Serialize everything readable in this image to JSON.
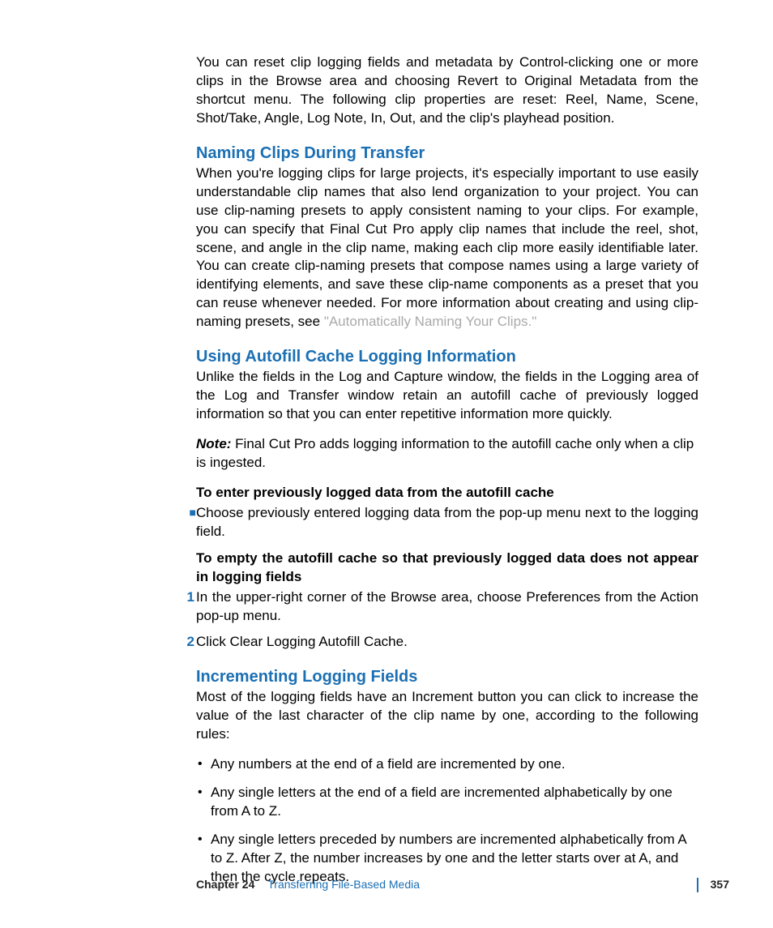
{
  "intro": "You can reset clip logging fields and metadata by Control-clicking one or more clips in the Browse area and choosing Revert to Original Metadata from the shortcut menu. The following clip properties are reset: Reel, Name, Scene, Shot/Take, Angle, Log Note, In, Out, and the clip's playhead position.",
  "s1": {
    "title": "Naming Clips During Transfer",
    "body_a": "When you're logging clips for large projects, it's especially important to use easily understandable clip names that also lend organization to your project. You can use clip-naming presets to apply consistent naming to your clips. For example, you can specify that Final Cut Pro apply clip names that include the reel, shot, scene, and angle in the clip name, making each clip more easily identifiable later. You can create clip-naming presets that compose names using a large variety of identifying elements, and save these clip-name components as a preset that you can reuse whenever needed. For more information about creating and using clip-naming presets, see ",
    "link": "\"Automatically Naming Your Clips.\""
  },
  "s2": {
    "title": "Using Autofill Cache Logging Information",
    "body": "Unlike the fields in the Log and Capture window, the fields in the Logging area of the Log and Transfer window retain an autofill cache of previously logged information so that you can enter repetitive information more quickly.",
    "note_label": "Note:",
    "note": "  Final Cut Pro adds logging information to the autofill cache only when a clip is ingested.",
    "sub1": "To enter previously logged data from the autofill cache",
    "bullet1": "Choose previously entered logging data from the pop-up menu next to the logging field.",
    "sub2": "To empty the autofill cache so that previously logged data does not appear in logging fields",
    "step1": "In the upper-right corner of the Browse area, choose Preferences from the Action pop-up menu.",
    "step2": "Click Clear Logging Autofill Cache."
  },
  "s3": {
    "title": "Incrementing Logging Fields",
    "body": "Most of the logging fields have an Increment button you can click to increase the value of the last character of the clip name by one, according to the following rules:",
    "b1": "Any numbers at the end of a field are incremented by one.",
    "b2": "Any single letters at the end of a field are incremented alphabetically by one from A to Z.",
    "b3": "Any single letters preceded by numbers are incremented alphabetically from A to Z. After Z, the number increases by one and the letter starts over at A, and then the cycle repeats."
  },
  "footer": {
    "chapter_label": "Chapter 24",
    "chapter_title": "Transferring File-Based Media",
    "page": "357"
  },
  "markers": {
    "one": "1",
    "two": "2"
  }
}
